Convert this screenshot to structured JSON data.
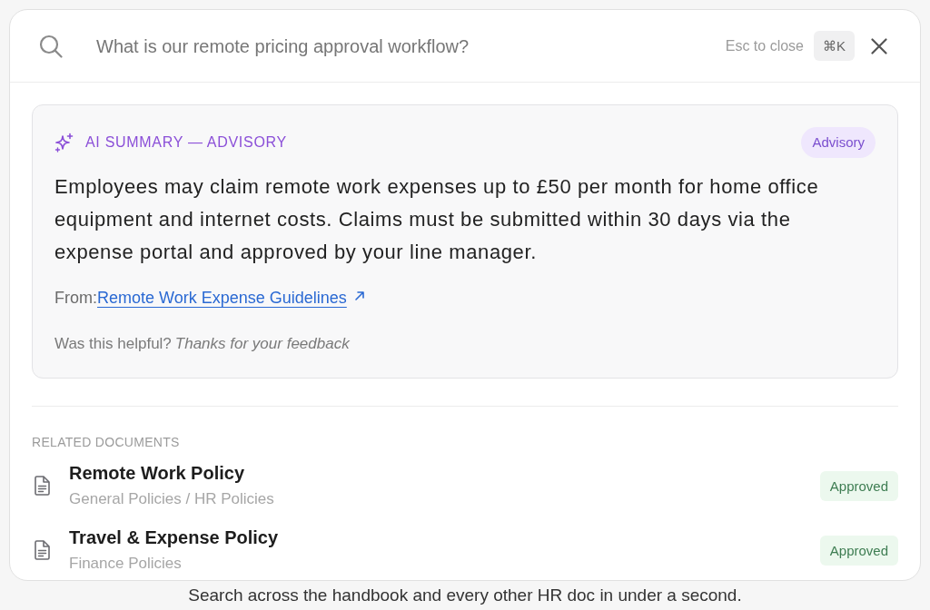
{
  "search": {
    "placeholder": "What is our remote pricing approval workflow?",
    "hint": "Esc to close",
    "shortcut": "⌘K"
  },
  "summary": {
    "heading": "AI SUMMARY — ADVISORY",
    "badge": "Advisory",
    "text": "Employees may claim remote work expenses up to £50 per month for home office equipment and internet costs. Claims must be submitted within 30 days via the expense portal and approved by your line manager.",
    "source_label": "From:",
    "source_link": "Remote Work Expense Guidelines",
    "feedback_question": "Was this helpful?",
    "feedback_response": "Thanks for your feedback"
  },
  "related": {
    "heading": "RELATED DOCUMENTS",
    "documents": [
      {
        "title": "Remote Work Policy",
        "path": "General Policies / HR Policies",
        "status": "Approved"
      },
      {
        "title": "Travel & Expense Policy",
        "path": "Finance Policies",
        "status": "Approved"
      }
    ]
  },
  "caption": "Search across the handbook and every other HR doc in under a second."
}
